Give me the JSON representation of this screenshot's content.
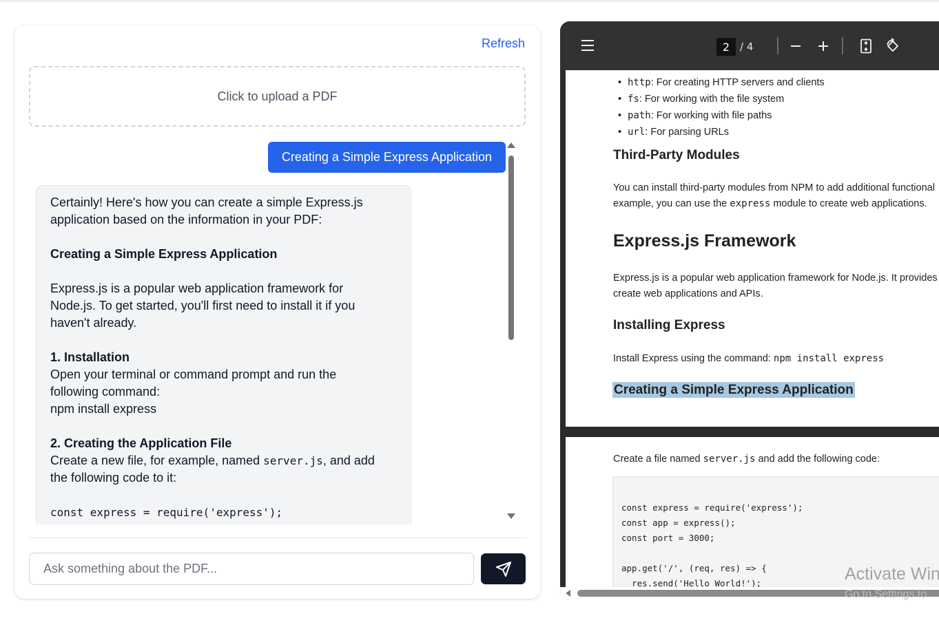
{
  "chat": {
    "refresh_label": "Refresh",
    "upload_label": "Click to upload a PDF",
    "user_message": "Creating a Simple Express Application",
    "assistant_message": {
      "intro_1": "Certainly! Here's how you can create a simple Express.js",
      "intro_2": "application based on the information in your PDF:",
      "heading": "Creating a Simple Express Application",
      "para_1": "Express.js is a popular web application framework for",
      "para_2": "Node.js. To get started, you'll first need to install it if you",
      "para_3": "haven't already.",
      "step1_title": "1. Installation",
      "step1_line1": "Open your terminal or command prompt and run the",
      "step1_line2": "following command:",
      "step1_cmd": "npm install express",
      "step2_title": "2. Creating the Application File",
      "step2_line1_pre": "Create a new file, for example, named ",
      "step2_filename": "server.js",
      "step2_line1_post": ", and add",
      "step2_line2": "the following code to it:",
      "code_line": "const express = require('express');"
    },
    "input_placeholder": "Ask something about the PDF..."
  },
  "pdf": {
    "current_page": "2",
    "page_separator": "/ 4",
    "bullets": [
      {
        "code": "http",
        "text": ": For creating HTTP servers and clients"
      },
      {
        "code": "fs",
        "text": ": For working with the file system"
      },
      {
        "code": "path",
        "text": ": For working with file paths"
      },
      {
        "code": "url",
        "text": ": For parsing URLs"
      }
    ],
    "third_party_heading": "Third-Party Modules",
    "third_party_line1": "You can install third-party modules from NPM to add additional functional",
    "third_party_line2_pre": "example, you can use the ",
    "third_party_code": "express",
    "third_party_line2_post": " module to create web applications.",
    "express_heading": "Express.js Framework",
    "express_line1": "Express.js is a popular web application framework for Node.js. It provides",
    "express_line2": "create web applications and APIs.",
    "installing_heading": "Installing Express",
    "installing_line_pre": "Install Express using the command: ",
    "installing_code": "npm install express",
    "creating_heading": "Creating a Simple Express Application",
    "page2_line_pre": "Create a file named ",
    "page2_code": "server.js",
    "page2_line_post": " and add the following code:",
    "code_lines": [
      "const express = require('express');",
      "const app = express();",
      "const port = 3000;",
      "",
      "app.get('/', (req, res) => {",
      "  res.send('Hello World!');"
    ]
  },
  "watermark": {
    "title": "Activate Win",
    "subtitle": "Go to Settings to"
  },
  "colors": {
    "primary": "#2563eb",
    "send_button": "#111827",
    "highlight": "#a6c8e0"
  }
}
